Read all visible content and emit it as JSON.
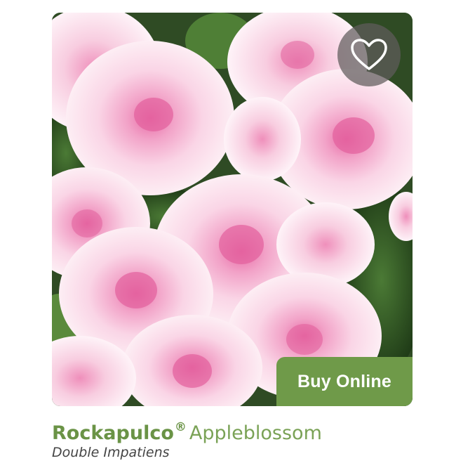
{
  "product": {
    "brand": "Rockapulco",
    "registered_mark": "®",
    "variety": "Appleblossom",
    "subtitle": "Double Impatiens",
    "buy_label": "Buy Online",
    "image_icon": "flower-photo",
    "favorite_icon": "heart-outline-icon"
  },
  "colors": {
    "accent_green": "#6f9a49",
    "title_green": "#6a9346",
    "subtitle_gray": "#444444",
    "favorite_bg": "#5f5c5c"
  }
}
